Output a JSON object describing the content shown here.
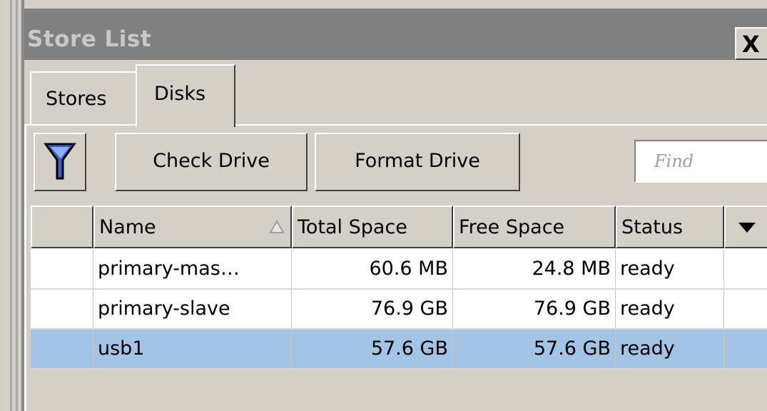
{
  "window": {
    "title": "Store List",
    "close_label": "X"
  },
  "tabs": [
    {
      "label": "Stores",
      "active": false
    },
    {
      "label": "Disks",
      "active": true
    }
  ],
  "toolbar": {
    "filter_icon": "filter-icon",
    "check_label": "Check Drive",
    "format_label": "Format Drive",
    "find_placeholder": "Find"
  },
  "table": {
    "columns": [
      "Name",
      "Total Space",
      "Free Space",
      "Status"
    ],
    "sort_column": "Name",
    "rows": [
      {
        "name": "primary-mas…",
        "total": "60.6 MB",
        "free": "24.8 MB",
        "status": "ready",
        "selected": false
      },
      {
        "name": "primary-slave",
        "total": "76.9 GB",
        "free": "76.9 GB",
        "status": "ready",
        "selected": false
      },
      {
        "name": "usb1",
        "total": "57.6 GB",
        "free": "57.6 GB",
        "status": "ready",
        "selected": true
      }
    ]
  },
  "colors": {
    "selection": "#a3c4e6",
    "titlebar": "#808080",
    "face": "#d4d0c8"
  }
}
